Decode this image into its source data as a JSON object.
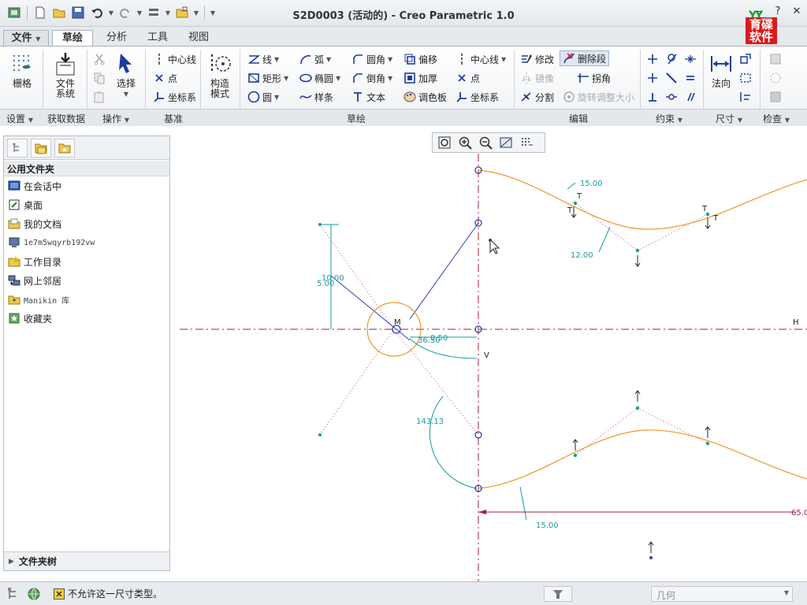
{
  "window": {
    "title": "S2D0003 (活动的) - Creo Parametric 1.0",
    "logo_text": "育碟软件"
  },
  "tabs": [
    {
      "label": "文件",
      "dropdown": true
    },
    {
      "label": "草绘",
      "active": true
    },
    {
      "label": "分析"
    },
    {
      "label": "工具"
    },
    {
      "label": "视图"
    }
  ],
  "ribbon": {
    "setup": {
      "grid": "栅格",
      "group": "设置"
    },
    "data": {
      "filesystem": "文件\n系统",
      "group": "获取数据"
    },
    "ops": {
      "select": "选择",
      "group": "操作"
    },
    "datum": {
      "centerline": "中心线",
      "point": "点",
      "coordsys": "坐标系",
      "group": "基准"
    },
    "construct": {
      "label": "构造\n模式"
    },
    "sketch": {
      "line": "线",
      "arc": "弧",
      "fillet": "圆角",
      "offset": "偏移",
      "centerline": "中心线",
      "rectangle": "矩形",
      "ellipse": "椭圆",
      "chamfer": "倒角",
      "thicken": "加厚",
      "point": "点",
      "circle": "圆",
      "spline": "样条",
      "text": "文本",
      "palette": "调色板",
      "coordsys": "坐标系",
      "group": "草绘"
    },
    "edit": {
      "modify": "修改",
      "delete_segment": "删除段",
      "mirror": "镜像",
      "corner": "拐角",
      "divide": "分割",
      "rotate_resize": "旋转调整大小",
      "group": "编辑"
    },
    "constrain": {
      "group": "约束"
    },
    "dimension": {
      "normal": "法向",
      "group": "尺寸"
    },
    "inspect": {
      "group": "检查"
    }
  },
  "left_panel": {
    "header": "公用文件夹",
    "items": [
      {
        "label": "在会话中",
        "icon": "session-icon"
      },
      {
        "label": "桌面",
        "icon": "desktop-icon"
      },
      {
        "label": "我的文档",
        "icon": "documents-icon"
      },
      {
        "label": "1e7m5wqyrb192vw",
        "icon": "computer-icon"
      },
      {
        "label": "工作目录",
        "icon": "working-dir-icon"
      },
      {
        "label": "网上邻居",
        "icon": "network-icon"
      },
      {
        "label": "Manikin 库",
        "icon": "manikin-icon"
      },
      {
        "label": "收藏夹",
        "icon": "favorites-icon"
      }
    ],
    "footer": "文件夹树"
  },
  "sketch": {
    "dims": {
      "d_top": "15.00",
      "d_mid": "12.00",
      "d_bot": "15.00",
      "d_10": "10.00",
      "d_5": "5.00",
      "d_angle": "143.13",
      "d_365": "36.50",
      "d_850": "8.50",
      "d_len": "65.0"
    },
    "axis_h": "H",
    "axis_v": "V",
    "constraint_t": "T",
    "center_m": "M"
  },
  "status": {
    "message": "不允许这一尺寸类型。",
    "filter": "几何"
  },
  "colors": {
    "curve": "#e89a2a",
    "dimension": "#1a9a9a",
    "centerline": "#a0203a",
    "vertex": "#2f3fb0"
  }
}
